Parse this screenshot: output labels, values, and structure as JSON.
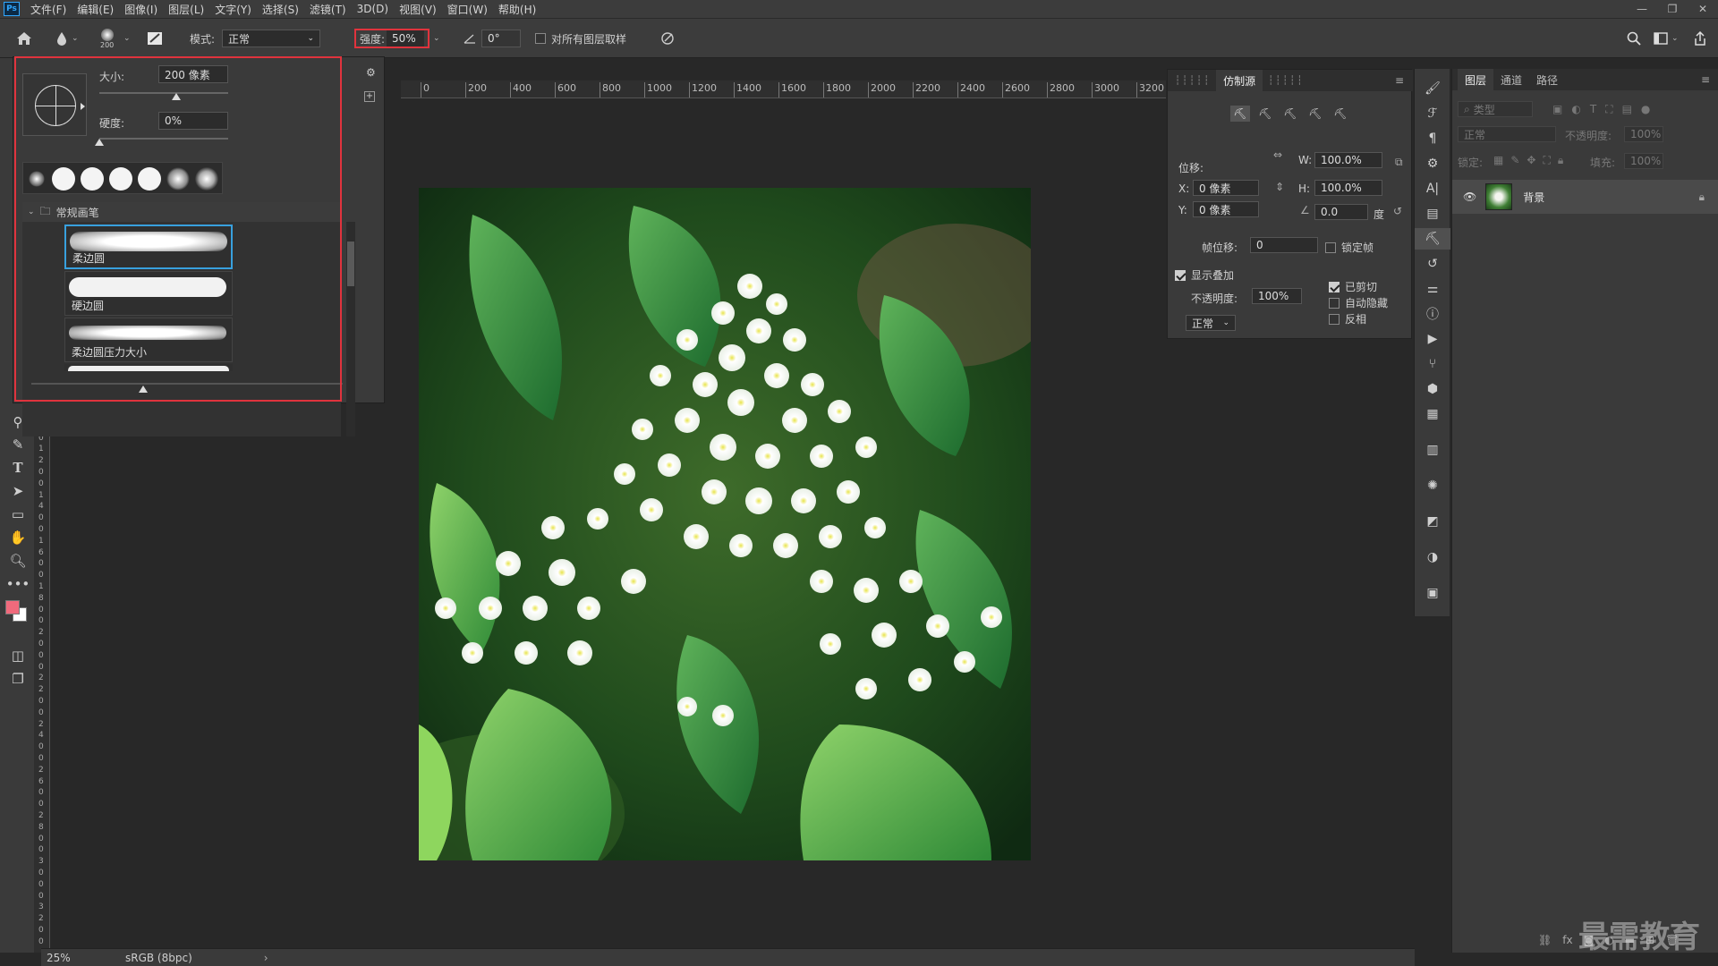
{
  "menu": [
    "文件(F)",
    "编辑(E)",
    "图像(I)",
    "图层(L)",
    "文字(Y)",
    "选择(S)",
    "滤镜(T)",
    "3D(D)",
    "视图(V)",
    "窗口(W)",
    "帮助(H)"
  ],
  "window_controls": [
    "—",
    "❐",
    "✕"
  ],
  "options": {
    "brush_size_small": "200",
    "mode_label": "模式:",
    "mode_value": "正常",
    "strength_label": "强度:",
    "strength_value": "50%",
    "angle_value": "0°",
    "sample_all_layers": "对所有图层取样"
  },
  "brush_picker": {
    "size_label": "大小:",
    "size_value": "200 像素",
    "size_slider": 0.6,
    "hardness_label": "硬度:",
    "hardness_value": "0%",
    "hardness_slider": 0.0,
    "folder_label": "常规画笔",
    "brushes": [
      "柔边圆",
      "硬边圆",
      "柔边圆压力大小"
    ]
  },
  "ruler_ticks": [
    "0",
    "200",
    "400",
    "600",
    "800",
    "1000",
    "1200",
    "1400",
    "1600",
    "1800",
    "2000",
    "2200",
    "2400",
    "2600",
    "2800",
    "3000",
    "3200"
  ],
  "vruler_ticks": [
    "1",
    "0",
    "0",
    "1",
    "2",
    "0",
    "0",
    "1",
    "4",
    "0",
    "0",
    "1",
    "6",
    "0",
    "0",
    "1",
    "8",
    "0",
    "0",
    "2",
    "0",
    "0",
    "0",
    "2",
    "2",
    "0",
    "0",
    "2",
    "4",
    "0",
    "0",
    "2",
    "6",
    "0",
    "0",
    "2",
    "8",
    "0",
    "0",
    "3",
    "0",
    "0",
    "0",
    "3",
    "2",
    "0",
    "0"
  ],
  "clone_source": {
    "tab_active": "仿制源",
    "offset_label": "位移:",
    "x_label": "X:",
    "x_value": "0 像素",
    "y_label": "Y:",
    "y_value": "0 像素",
    "w_label": "W:",
    "w_value": "100.0%",
    "h_label": "H:",
    "h_value": "100.0%",
    "angle_value": "0.0",
    "angle_unit": "度",
    "frame_offset_label": "帧位移:",
    "frame_offset_value": "0",
    "lock_frame": "锁定帧",
    "show_overlay": "显示叠加",
    "opacity_label": "不透明度:",
    "opacity_value": "100%",
    "blend_value": "正常",
    "clipped": "已剪切",
    "auto_hide": "自动隐藏",
    "invert": "反相"
  },
  "layers": {
    "tabs": [
      "图层",
      "通道",
      "路径"
    ],
    "filter_placeholder": "类型",
    "blend_mode": "正常",
    "opacity_label": "不透明度:",
    "opacity_value": "100%",
    "lock_label": "锁定:",
    "fill_label": "填充:",
    "fill_value": "100%",
    "layer_name": "背景"
  },
  "status": {
    "zoom": "25%",
    "color_profile": "sRGB (8bpc)"
  },
  "watermark": "最需教育",
  "colors": {
    "accent_red": "#e0333d",
    "foreground": "#f06a7c",
    "background": "#ffffff",
    "selection_blue": "#38a0de"
  }
}
